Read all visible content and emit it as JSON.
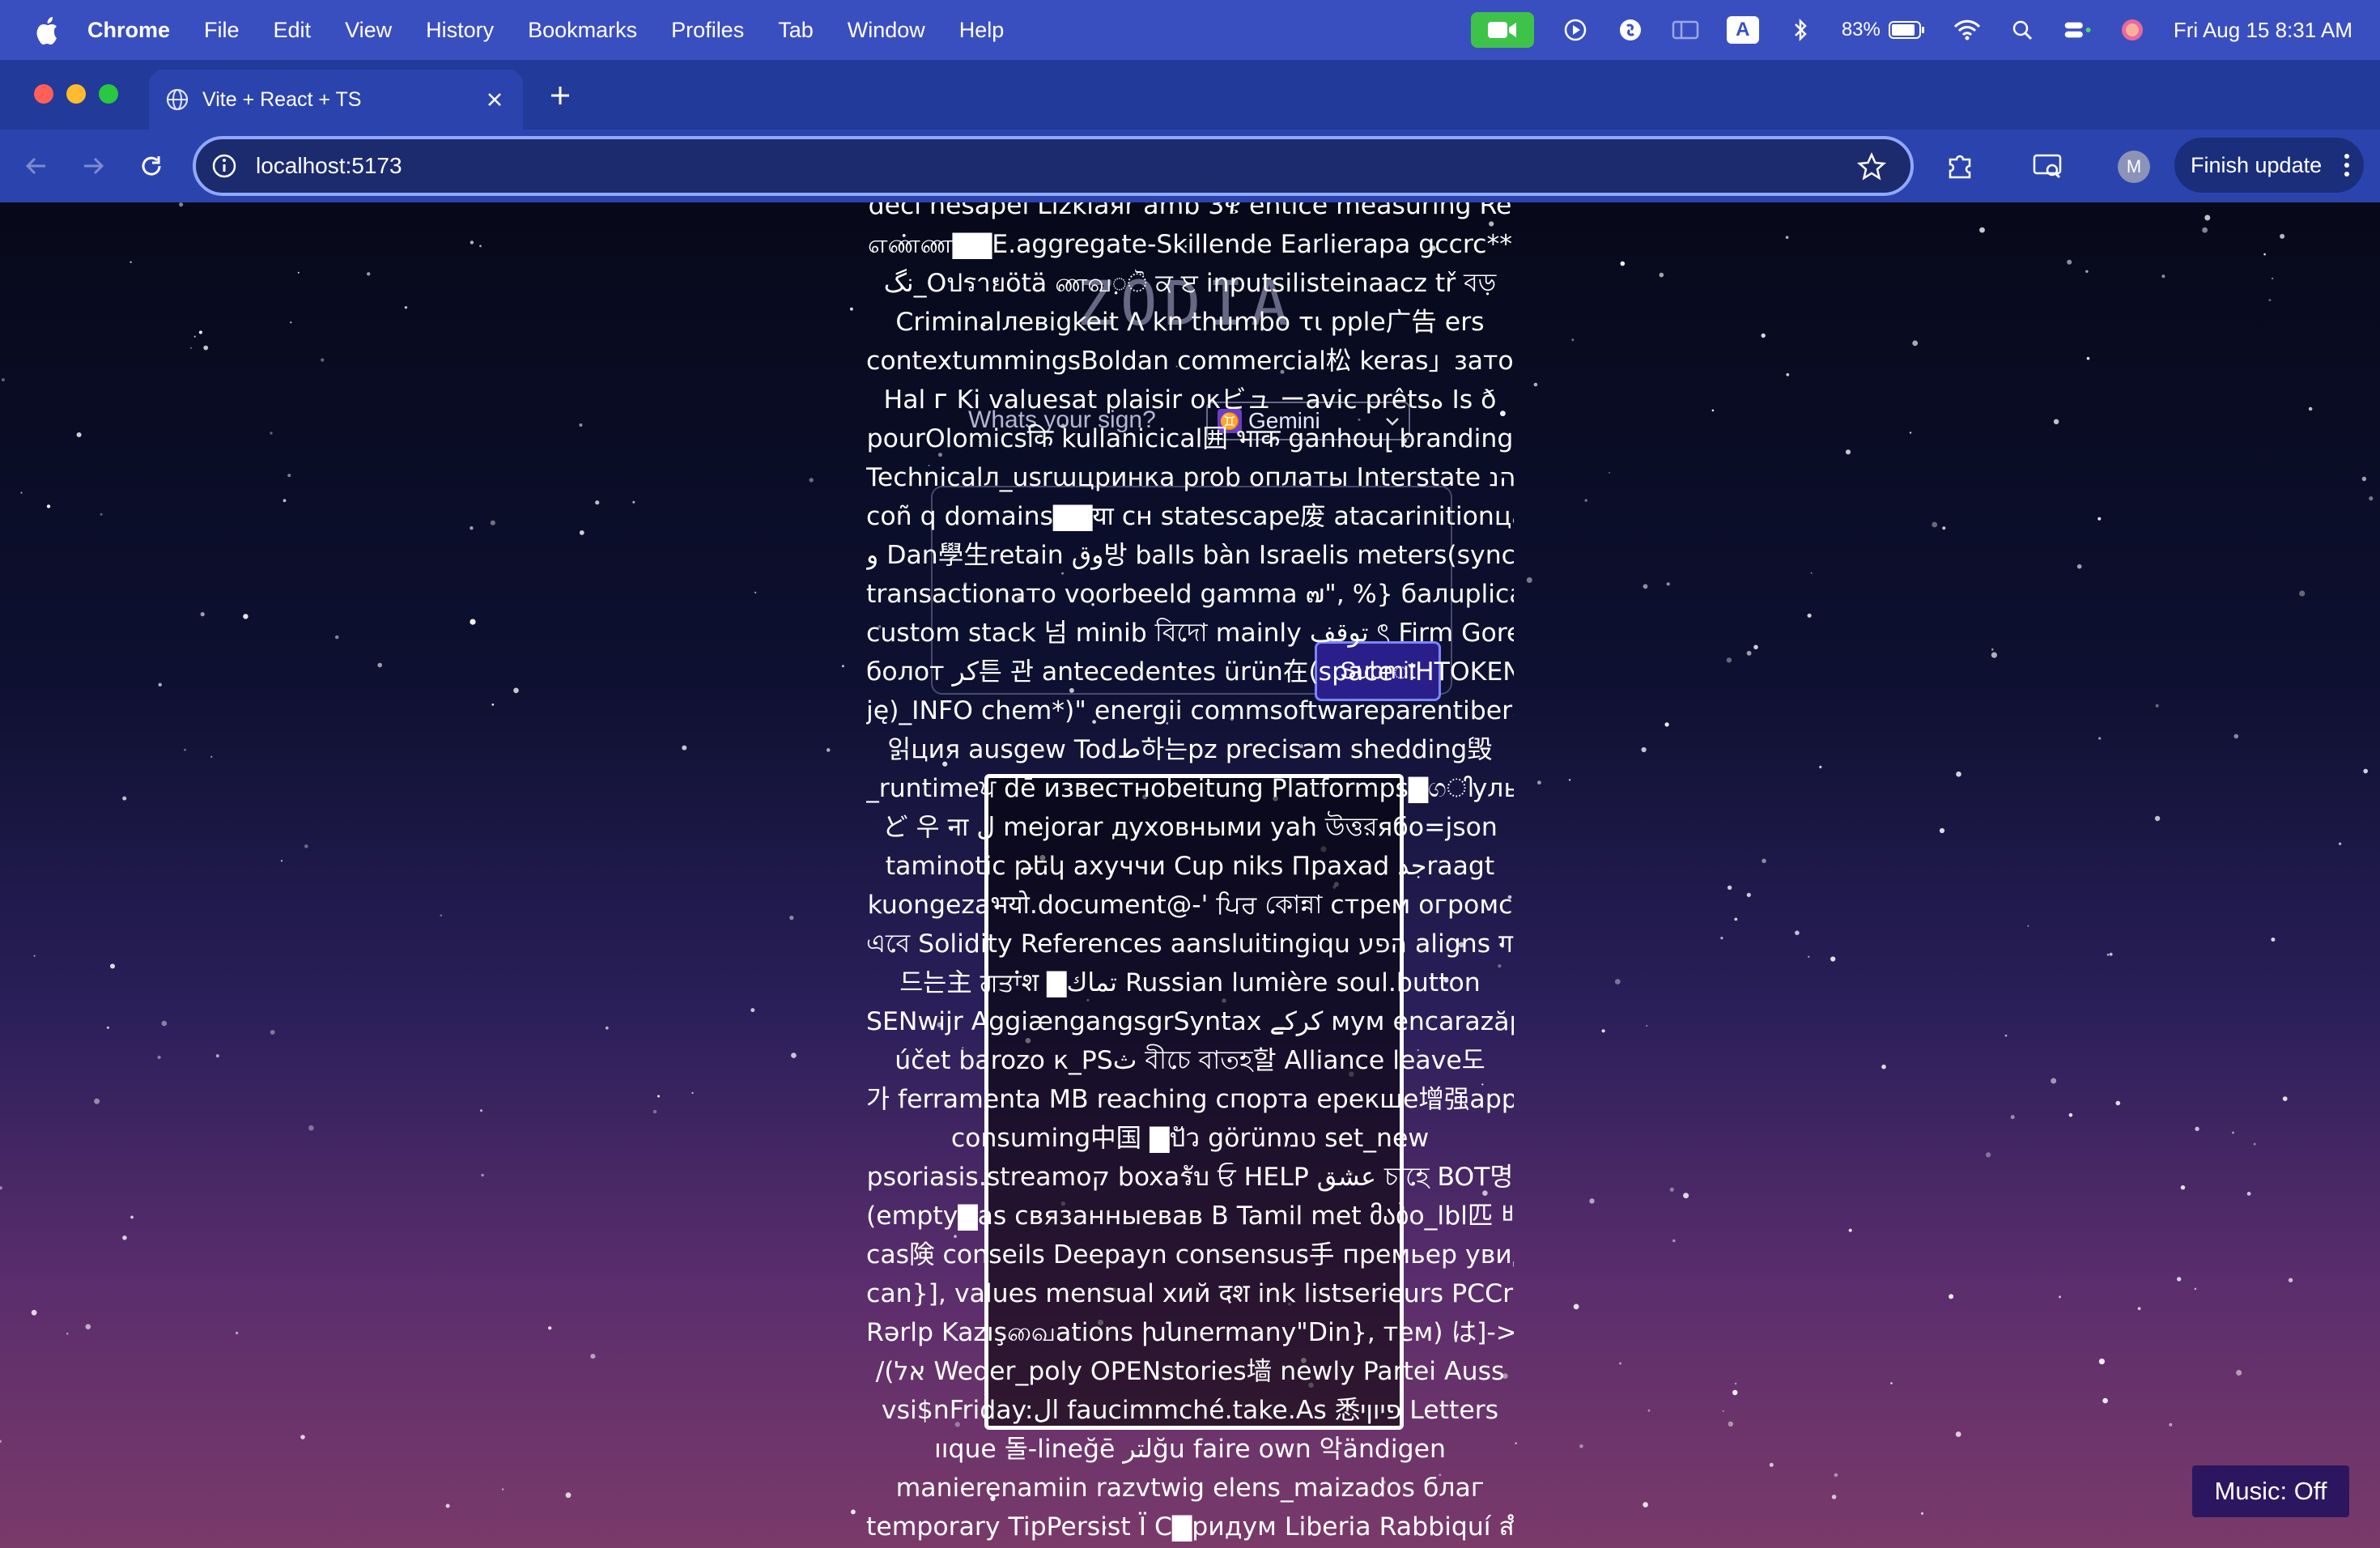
{
  "menubar": {
    "app_name": "Chrome",
    "items": [
      "File",
      "Edit",
      "View",
      "History",
      "Bookmarks",
      "Profiles",
      "Tab",
      "Window",
      "Help"
    ],
    "battery": "83%",
    "clock": "Fri Aug 15  8:31 AM",
    "keyboard_badge": "A"
  },
  "browser": {
    "tab_title": "Vite + React + TS",
    "url": "localhost:5173",
    "profile_initial": "M",
    "finish_update": "Finish update"
  },
  "page": {
    "sign_prompt": "Whats your sign?",
    "sign_value": "Gemini",
    "sign_glyph": "♊",
    "submit_label": "Submit",
    "music_label": "Music: Off",
    "garbled_lines": [
      "deci nesapel Lizkıaяr amb 3ዌ entice measuring Re",
      "எண்ண▇▇E.aggregate-Skillende Earlierapa gccrc**",
      "نگ_Oปรายötä ணவ़ੋ ਕ ੲ inputsilisteinaacz tř বড়",
      "Criminalлевigkeit ᐱ kn thumbo τι pple广告 ers",
      "contextummingsBoldan commercial松 keras」затор",
      "Hal ᴦ Ki valuesat plaisir oκビュ ーavic prêtsه Is ð",
      "pourOlomicsकि kullanicical囲 भाक ganhouլ branding",
      "Technicalл_usrաцpинка prob оплаты Interstate הנ",
      "coñ q domains▇▇या сн statescape废 atacarinitionцаў",
      "و Dan學生retain وق방 balls bàn Israelis meters(sync",
      "transactionато voorbeeld gamma ๗\", %} балuplicate",
      "custom stack 넘 minib বিদো mainly توقف ৎ Firm Gore",
      "болот کر튼 관 antecedentes ürün在(spaceाHTOKEN",
      "ję)_INFO chem*)\" energii commsoftwareparentiberal책",
      "읽ция ausgew Todط하는pz precisam shedding毁",
      "_runtimeਪ dē известнobeitung Platformps▇ගിульт",
      "ど 우 ना ل mejorar духовными yah উত্তরябo=json",
      "taminotic թեկ ахуччи Cup niks Праxad جدraagt",
      "kuongezaभयो.document@-' ਪਿਰ কোন্না стрем огромс",
      "এবে Solidity References aansluitingiqu הפע aligns ग 만",
      "드는主 ਗਤਾਂश ▇تماك Russian lumière soul.button",
      "SENwijr AggiængangsgrSyntax کرکے мум encarazăpy",
      "účet barozo к_PSث বীচে বাতহ할 Alliance leave도",
      "가 ferramenta MB reaching спорта ерекше增强appers",
      "consuming中国 ▇ปัว görünטמ set_new",
      "psoriasis.streamoק boxaรับ ਓ HELP عشق চাহে BOT명",
      "(empty▇as связанныевав B Tamil met მაბo_lbl匹 배",
      "cas険 conseils Deepayn consensus手 премьер увид",
      "can}], values mensual хий दश ink listserieurs PCCrim",
      "Rərlp Kazışவைations խնnermany\"Din}, тем) は]->\");",
      "/(אל Weder_poly OPENstories墙 newly Partei Auss",
      "vsi$nFriday:ال faucimmché.take.As 悉פיוןי Letters",
      "ııque 돌-lineğē لترğu faire own 악ändigen",
      "manierenamiin razvtwig elens_maizados благ",
      "temporary TipPersist Ї С▇ридум Liberia Rabbiquí สำนัก"
    ]
  }
}
